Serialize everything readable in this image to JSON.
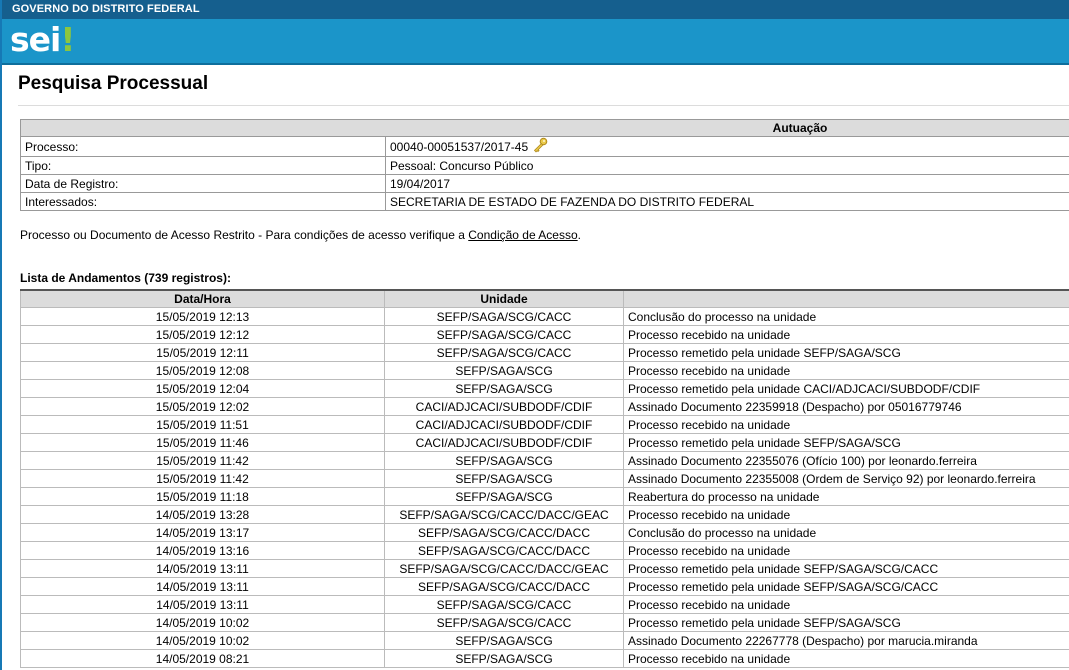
{
  "header": {
    "gov_label": "GOVERNO DO DISTRITO FEDERAL",
    "logo_text": "sei",
    "logo_mark": "!"
  },
  "page": {
    "title": "Pesquisa Processual"
  },
  "info": {
    "section_header": "Autuação",
    "rows": [
      {
        "label": "Processo:",
        "value": "00040-00051537/2017-45",
        "icon": "key-icon"
      },
      {
        "label": "Tipo:",
        "value": "Pessoal: Concurso Público"
      },
      {
        "label": "Data de Registro:",
        "value": "19/04/2017"
      },
      {
        "label": "Interessados:",
        "value": "SECRETARIA DE ESTADO DE FAZENDA DO DISTRITO FEDERAL"
      }
    ]
  },
  "access_note": {
    "text": "Processo ou Documento de Acesso Restrito - Para condições de acesso verifique a ",
    "link": "Condição de Acesso",
    "suffix": "."
  },
  "andamentos": {
    "caption": "Lista de Andamentos (739 registros):",
    "columns": [
      "Data/Hora",
      "Unidade",
      ""
    ],
    "rows": [
      [
        "15/05/2019 12:13",
        "SEFP/SAGA/SCG/CACC",
        "Conclusão do processo na unidade"
      ],
      [
        "15/05/2019 12:12",
        "SEFP/SAGA/SCG/CACC",
        "Processo recebido na unidade"
      ],
      [
        "15/05/2019 12:11",
        "SEFP/SAGA/SCG/CACC",
        "Processo remetido pela unidade SEFP/SAGA/SCG"
      ],
      [
        "15/05/2019 12:08",
        "SEFP/SAGA/SCG",
        "Processo recebido na unidade"
      ],
      [
        "15/05/2019 12:04",
        "SEFP/SAGA/SCG",
        "Processo remetido pela unidade CACI/ADJCACI/SUBDODF/CDIF"
      ],
      [
        "15/05/2019 12:02",
        "CACI/ADJCACI/SUBDODF/CDIF",
        "Assinado Documento 22359918 (Despacho) por 05016779746"
      ],
      [
        "15/05/2019 11:51",
        "CACI/ADJCACI/SUBDODF/CDIF",
        "Processo recebido na unidade"
      ],
      [
        "15/05/2019 11:46",
        "CACI/ADJCACI/SUBDODF/CDIF",
        "Processo remetido pela unidade SEFP/SAGA/SCG"
      ],
      [
        "15/05/2019 11:42",
        "SEFP/SAGA/SCG",
        "Assinado Documento 22355076 (Ofício 100) por leonardo.ferreira"
      ],
      [
        "15/05/2019 11:42",
        "SEFP/SAGA/SCG",
        "Assinado Documento 22355008 (Ordem de Serviço 92) por leonardo.ferreira"
      ],
      [
        "15/05/2019 11:18",
        "SEFP/SAGA/SCG",
        "Reabertura do processo na unidade"
      ],
      [
        "14/05/2019 13:28",
        "SEFP/SAGA/SCG/CACC/DACC/GEAC",
        "Processo recebido na unidade"
      ],
      [
        "14/05/2019 13:17",
        "SEFP/SAGA/SCG/CACC/DACC",
        "Conclusão do processo na unidade"
      ],
      [
        "14/05/2019 13:16",
        "SEFP/SAGA/SCG/CACC/DACC",
        "Processo recebido na unidade"
      ],
      [
        "14/05/2019 13:11",
        "SEFP/SAGA/SCG/CACC/DACC/GEAC",
        "Processo remetido pela unidade SEFP/SAGA/SCG/CACC"
      ],
      [
        "14/05/2019 13:11",
        "SEFP/SAGA/SCG/CACC/DACC",
        "Processo remetido pela unidade SEFP/SAGA/SCG/CACC"
      ],
      [
        "14/05/2019 13:11",
        "SEFP/SAGA/SCG/CACC",
        "Processo recebido na unidade"
      ],
      [
        "14/05/2019 10:02",
        "SEFP/SAGA/SCG/CACC",
        "Processo remetido pela unidade SEFP/SAGA/SCG"
      ],
      [
        "14/05/2019 10:02",
        "SEFP/SAGA/SCG",
        "Assinado Documento 22267778 (Despacho) por marucia.miranda"
      ],
      [
        "14/05/2019 08:21",
        "SEFP/SAGA/SCG",
        "Processo recebido na unidade"
      ]
    ]
  },
  "colors": {
    "gov_bar": "#155f8e",
    "sei_bar": "#1b95c9",
    "logo_accent": "#8cc63f",
    "header_cell": "#dcdcdc"
  }
}
